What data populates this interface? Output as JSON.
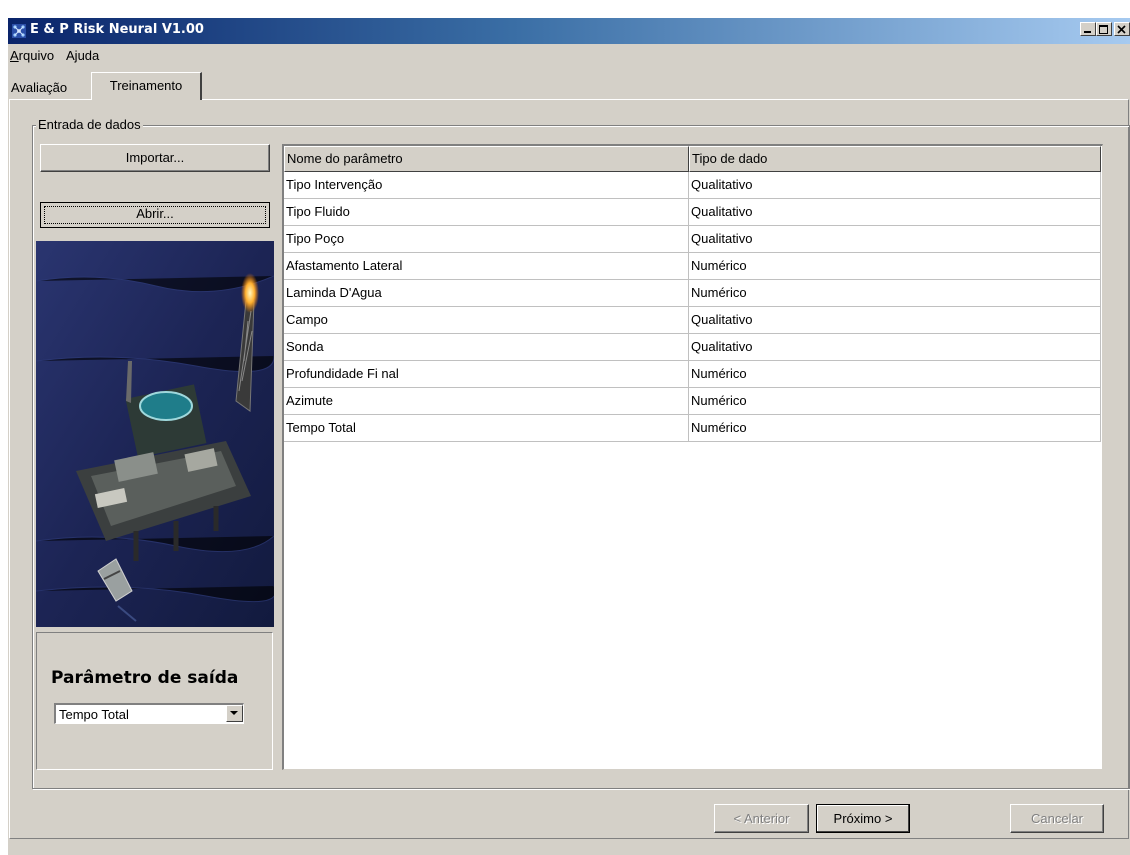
{
  "window": {
    "title": "E & P Risk Neural V1.00",
    "controls": [
      "minimize-icon",
      "maximize-icon",
      "close-icon"
    ]
  },
  "menu": {
    "items": [
      {
        "mnemonic": "A",
        "rest": "rquivo"
      },
      {
        "pre": "A",
        "mnemonic": "j",
        "rest": "uda"
      }
    ]
  },
  "tabs": [
    {
      "label": "Avaliação",
      "active": false
    },
    {
      "label": "Treinamento",
      "active": true
    }
  ],
  "input_group": {
    "label": "Entrada de dados",
    "import_button": "Importar...",
    "open_button": "Abrir...",
    "image": "offshore-oil-platform"
  },
  "output": {
    "title": "Parâmetro de saída",
    "selected": "Tempo Total"
  },
  "table": {
    "columns": [
      "Nome do parâmetro",
      "Tipo de dado"
    ],
    "rows": [
      [
        "Tipo Intervenção",
        "Qualitativo"
      ],
      [
        "Tipo Fluido",
        "Qualitativo"
      ],
      [
        "Tipo Poço",
        "Qualitativo"
      ],
      [
        "Afastamento Lateral",
        "Numérico"
      ],
      [
        "Laminda D'Agua",
        "Numérico"
      ],
      [
        "Campo",
        "Qualitativo"
      ],
      [
        "Sonda",
        "Qualitativo"
      ],
      [
        "Profundidade Fi nal",
        "Numérico"
      ],
      [
        "Azimute",
        "Numérico"
      ],
      [
        "Tempo Total",
        "Numérico"
      ]
    ]
  },
  "nav": {
    "previous": "< Anterior",
    "next": "Próximo >",
    "cancel": "Cancelar"
  },
  "colors": {
    "title_start": "#0a246a",
    "title_end": "#a6caf0",
    "face": "#d4d0c8",
    "sea": "#1c2454"
  }
}
